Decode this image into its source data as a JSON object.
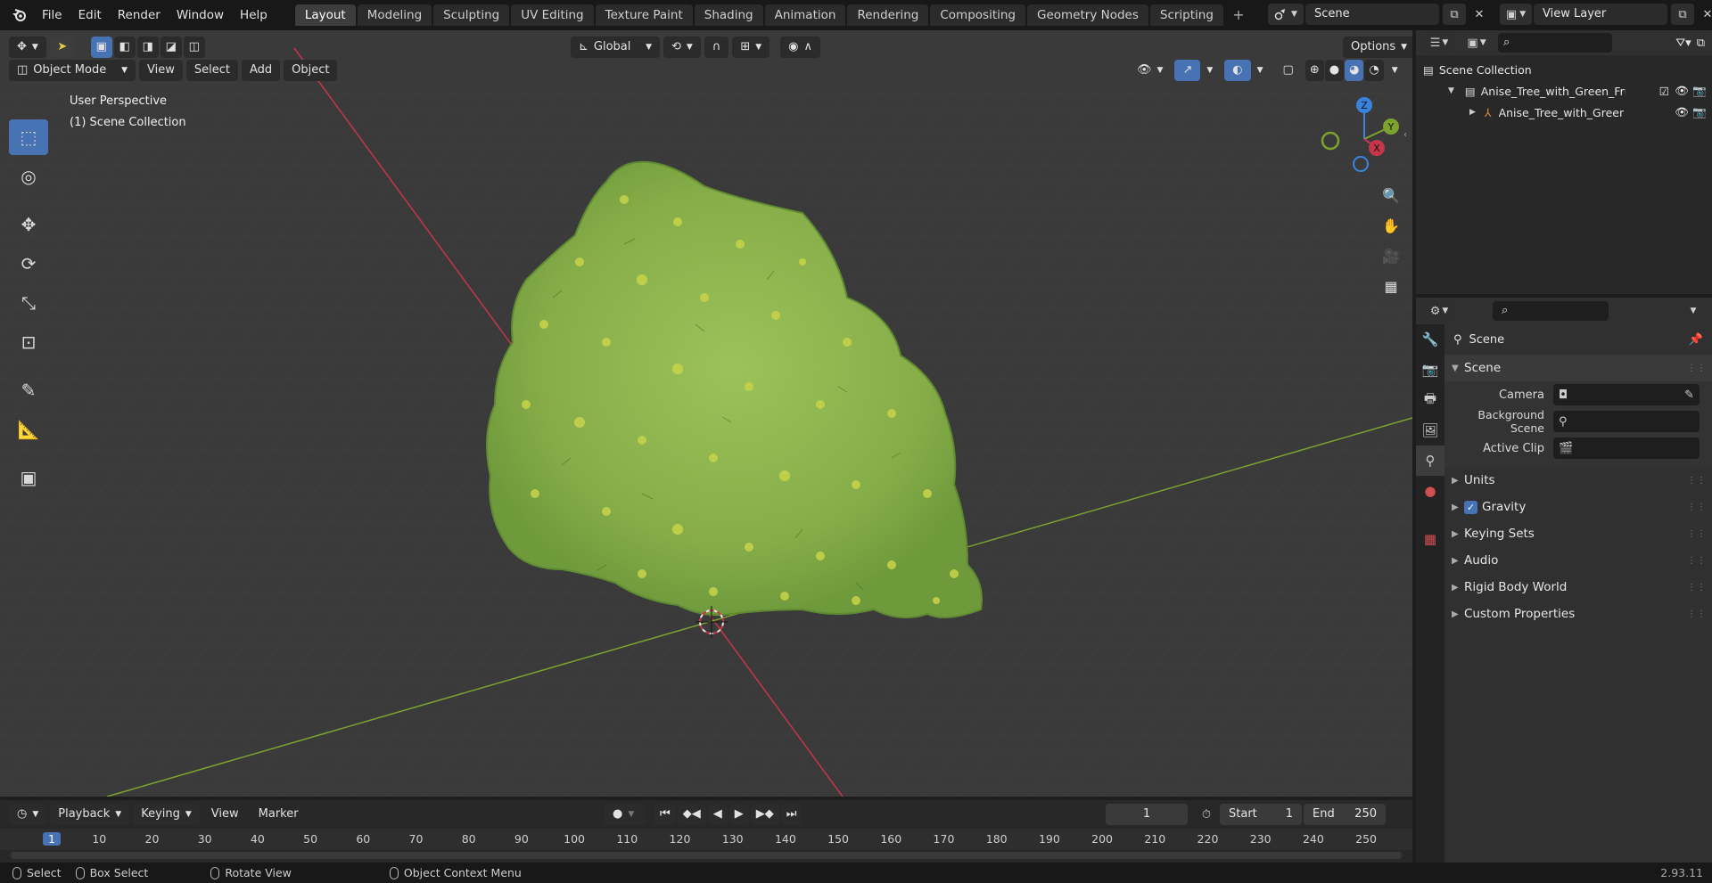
{
  "menu": {
    "logo": "blender-logo-icon",
    "items": [
      "File",
      "Edit",
      "Render",
      "Window",
      "Help"
    ]
  },
  "workspaces": {
    "tabs": [
      "Layout",
      "Modeling",
      "Sculpting",
      "UV Editing",
      "Texture Paint",
      "Shading",
      "Animation",
      "Rendering",
      "Compositing",
      "Geometry Nodes",
      "Scripting"
    ],
    "active": "Layout",
    "add": "+"
  },
  "scene": {
    "name": "Scene",
    "view_layer": "View Layer"
  },
  "viewport": {
    "transform_orientation": "Global",
    "options_label": "Options",
    "mode": "Object Mode",
    "header_menus": [
      "View",
      "Select",
      "Add",
      "Object"
    ],
    "perspective_label": "User Perspective",
    "collection_label": "(1) Scene Collection",
    "gizmo": {
      "x": "X",
      "y": "Y",
      "z": "Z"
    }
  },
  "outliner": {
    "root": "Scene Collection",
    "collection": "Anise_Tree_with_Green_Fruits",
    "object": "Anise_Tree_with_Green_I"
  },
  "properties": {
    "header_name": "Scene",
    "panel_title": "Scene",
    "fields": [
      {
        "label": "Camera",
        "value": ""
      },
      {
        "label": "Background Scene",
        "value": ""
      },
      {
        "label": "Active Clip",
        "value": ""
      }
    ],
    "sections": [
      {
        "label": "Units",
        "checkbox": false
      },
      {
        "label": "Gravity",
        "checkbox": true
      },
      {
        "label": "Keying Sets",
        "checkbox": false
      },
      {
        "label": "Audio",
        "checkbox": false
      },
      {
        "label": "Rigid Body World",
        "checkbox": false
      },
      {
        "label": "Custom Properties",
        "checkbox": false
      }
    ]
  },
  "timeline": {
    "menus": [
      "Playback",
      "Keying",
      "View",
      "Marker"
    ],
    "current_frame": "1",
    "start_label": "Start",
    "start": "1",
    "end_label": "End",
    "end": "250",
    "ruler": [
      "1",
      "10",
      "20",
      "30",
      "40",
      "50",
      "60",
      "70",
      "80",
      "90",
      "100",
      "110",
      "120",
      "130",
      "140",
      "150",
      "160",
      "170",
      "180",
      "190",
      "200",
      "210",
      "220",
      "230",
      "240",
      "250"
    ]
  },
  "statusbar": {
    "select": "Select",
    "box_select": "Box Select",
    "rotate_view": "Rotate View",
    "context_menu": "Object Context Menu",
    "version": "2.93.11"
  },
  "colors": {
    "accent": "#4772b3",
    "x_axis": "#c6364a",
    "y_axis": "#7da32f",
    "z_axis": "#3a82e0",
    "tree": "#8db54e"
  }
}
